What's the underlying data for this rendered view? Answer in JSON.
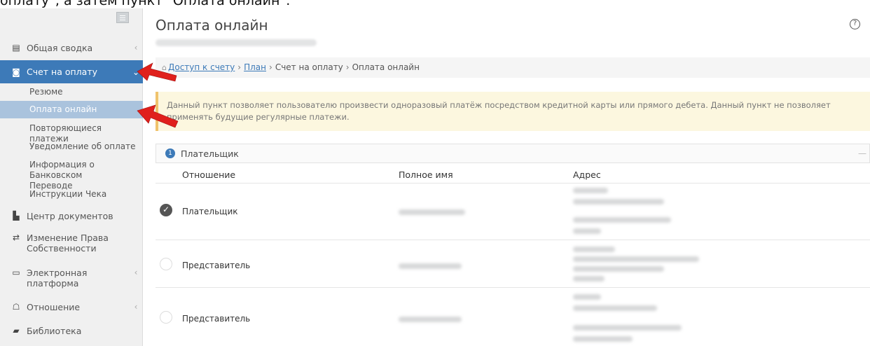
{
  "top_text": "оплату\", а затем пункт \"Оплата онлайн\".",
  "sidebar": {
    "items": [
      {
        "label": "Общая сводка",
        "icon": "summary-icon",
        "glyph": "▤",
        "caret": "‹"
      },
      {
        "label": "Счет на оплату",
        "icon": "invoice-icon",
        "glyph": "◙",
        "caret": "⌄"
      },
      {
        "label": "Центр документов",
        "icon": "documents-icon",
        "glyph": "▙"
      },
      {
        "label": "Изменение Права Собственности",
        "icon": "transfer-icon",
        "glyph": "⇄"
      },
      {
        "label": "Электронная платформа",
        "icon": "monitor-icon",
        "glyph": "▭",
        "caret": "‹"
      },
      {
        "label": "Отношение",
        "icon": "people-icon",
        "glyph": "☖",
        "caret": "‹"
      },
      {
        "label": "Библиотека",
        "icon": "book-icon",
        "glyph": "▰"
      }
    ],
    "sub_items": [
      "Резюме",
      "Оплата онлайн",
      "Повторяющиеся платежи",
      "Уведомление об оплате",
      "Информация о Банковском Переводе",
      "Инструкции Чека"
    ]
  },
  "main": {
    "title": "Оплата онлайн",
    "help": "?",
    "breadcrumb": {
      "home_icon": "⌂",
      "items": [
        "Доступ к счету",
        "План",
        "Счет на оплату",
        "Оплата онлайн"
      ],
      "sep": "›"
    },
    "notice": "Данный пункт позволяет пользователю произвести одноразовый платёж посредством кредитной карты или прямого дебета. Данный пункт не позволяет применять будущие регулярные платежи.",
    "panel": {
      "step": "1",
      "title": "Плательщик",
      "collapse": "—"
    },
    "columns": [
      "Отношение",
      "Полное имя",
      "Адрес"
    ],
    "rows": [
      {
        "relation": "Плательщик",
        "selected": true
      },
      {
        "relation": "Представитель",
        "selected": false
      },
      {
        "relation": "Представитель",
        "selected": false
      }
    ]
  },
  "colors": {
    "accent": "#3d7ab8",
    "selected_sub": "#aac3dd",
    "notice_border": "#f0c36d",
    "arrow": "#e0201c"
  }
}
